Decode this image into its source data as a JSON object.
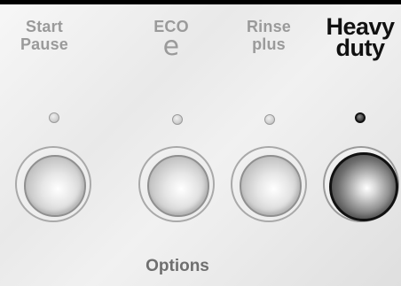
{
  "header": {
    "background": "#000000"
  },
  "buttons": [
    {
      "label_line1": "Start",
      "label_line2": "Pause",
      "led_state": "off",
      "active": false
    },
    {
      "label_line1": "ECO",
      "label_line2": "e",
      "led_state": "off",
      "active": false
    },
    {
      "label_line1": "Rinse",
      "label_line2": "plus",
      "led_state": "off",
      "active": false
    },
    {
      "label_line1": "Heavy",
      "label_line2": "duty",
      "led_state": "on",
      "active": true
    }
  ],
  "group_label": "Options",
  "colors": {
    "inactive_label": "#9a9a9a",
    "active_label": "#111111",
    "led_on": "#111111",
    "led_off": "#cfcfcf"
  }
}
